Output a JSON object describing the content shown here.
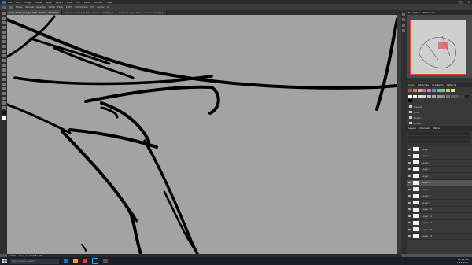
{
  "menu": {
    "items": [
      "File",
      "Edit",
      "Image",
      "Layer",
      "Type",
      "Select",
      "Filter",
      "3D",
      "View",
      "Window",
      "Help"
    ],
    "window_controls": [
      "–",
      "□",
      "✕"
    ]
  },
  "options": {
    "labels": [
      "Mode:",
      "Normal",
      "Opacity:",
      "100%",
      "Flow:",
      "100%",
      "Smoothing:",
      "0%",
      "Angle:",
      "0°"
    ]
  },
  "tabs": [
    {
      "label": "lego 4x6 p.psd @ 100% (Rotate, RGB/8) *"
    },
    {
      "label": "reference2.psd @ 50% (Layer 1, RGB/8) *"
    },
    {
      "label": "Untitled-1 @ 100% (Layer 2, RGB/8) *"
    }
  ],
  "status": {
    "zoom": "100%",
    "doc": "Doc: 23.4M/181.6M"
  },
  "panels": {
    "nav_tabs": [
      "Navigator",
      "Histogram"
    ],
    "swatch_tabs": [
      "Color",
      "Swatches",
      "Gradients",
      "Patterns"
    ],
    "folders": [
      "Neutral",
      "Blue",
      "Brown",
      "Green"
    ],
    "layers_tabs": [
      "Layers",
      "Channels",
      "Paths"
    ]
  },
  "layers": [
    "Layer 1",
    "Layer 2",
    "Layer 3",
    "Layer 4",
    "Layer 5",
    "Layer 6",
    "Layer 7",
    "Layer 8",
    "Layer 9",
    "Layer 10",
    "Layer 11",
    "Layer 12",
    "Layer 13",
    "Layer 14"
  ],
  "taskbar": {
    "search": "Type here to search",
    "time": "10:42 AM",
    "date": "1/16/2021"
  },
  "colors": {
    "canvas": "#a3a3a3",
    "panel": "#383838",
    "accent": "#1d5fa8"
  }
}
